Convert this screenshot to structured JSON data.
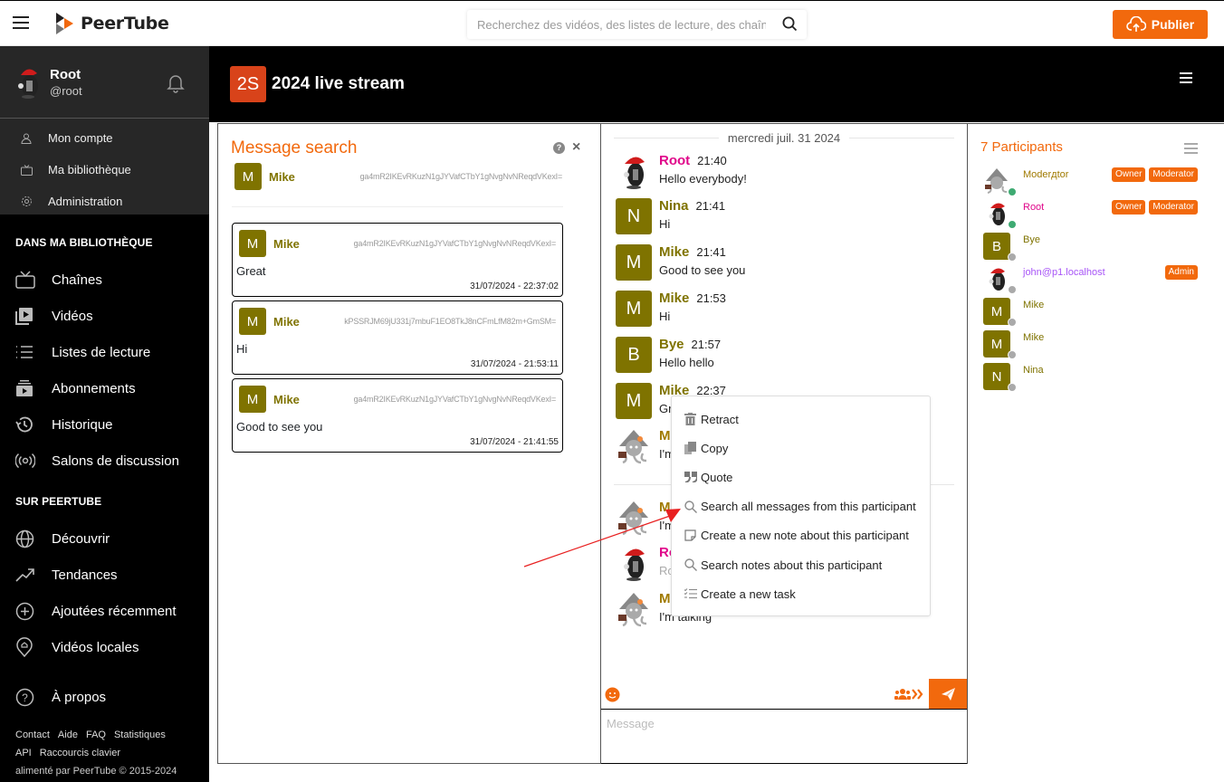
{
  "header": {
    "app_name": "PeerTube",
    "search_placeholder": "Recherchez des vidéos, des listes de lecture, des chaînes…",
    "publish_label": "Publier"
  },
  "sidebar": {
    "user": {
      "name": "Root",
      "handle": "@root"
    },
    "quick_links": [
      {
        "label": "Mon compte",
        "icon": "user-icon"
      },
      {
        "label": "Ma bibliothèque",
        "icon": "tv-icon"
      },
      {
        "label": "Administration",
        "icon": "gear-icon"
      }
    ],
    "library_title": "DANS MA BIBLIOTHÈQUE",
    "library_items": [
      {
        "label": "Chaînes",
        "icon": "tv-icon"
      },
      {
        "label": "Vidéos",
        "icon": "video-play-icon"
      },
      {
        "label": "Listes de lecture",
        "icon": "list-icon"
      },
      {
        "label": "Abonnements",
        "icon": "subscriptions-icon"
      },
      {
        "label": "Historique",
        "icon": "history-icon"
      },
      {
        "label": "Salons de discussion",
        "icon": "broadcast-icon"
      }
    ],
    "peertube_title": "SUR PEERTUBE",
    "peertube_items": [
      {
        "label": "Découvrir",
        "icon": "globe-icon"
      },
      {
        "label": "Tendances",
        "icon": "trending-icon"
      },
      {
        "label": "Ajoutées récemment",
        "icon": "plus-circle-icon"
      },
      {
        "label": "Vidéos locales",
        "icon": "location-icon"
      }
    ],
    "about_label": "À propos",
    "footer_links_row1": [
      "Contact",
      "Aide",
      "FAQ",
      "Statistiques"
    ],
    "footer_links_row2": [
      "API",
      "Raccourcis clavier"
    ],
    "powered_by": "alimenté par PeerTube © 2015-2024"
  },
  "live": {
    "badge": "2S",
    "title": "2024 live stream"
  },
  "message_search": {
    "title": "Message search",
    "help_label": "?",
    "close_label": "×",
    "filter": {
      "initial": "M",
      "name": "Mike",
      "id": "ga4mR2IKEvRKuzN1gJYVafCTbY1gNvgNvNReqdVKexI="
    },
    "results": [
      {
        "initial": "M",
        "name": "Mike",
        "id": "ga4mR2IKEvRKuzN1gJYVafCTbY1gNvgNvNReqdVKexI=",
        "text": "Great",
        "time": "31/07/2024 - 22:37:02"
      },
      {
        "initial": "M",
        "name": "Mike",
        "id": "kPSSRJM69jU331j7mbuF1EO8TkJ8nCFmLfM82m+GmSM=",
        "text": "Hi",
        "time": "31/07/2024 - 21:53:11"
      },
      {
        "initial": "M",
        "name": "Mike",
        "id": "ga4mR2IKEvRKuzN1gJYVafCTbY1gNvgNvNReqdVKexI=",
        "text": "Good to see you",
        "time": "31/07/2024 - 21:41:55"
      }
    ]
  },
  "chat": {
    "date": "mercredi juil. 31 2024",
    "messages": [
      {
        "author": "Root",
        "time": "21:40",
        "text": "Hello everybody!",
        "avatar": "penguin"
      },
      {
        "author": "Nina",
        "time": "21:41",
        "text": "Hi",
        "avatar": "N"
      },
      {
        "author": "Mike",
        "time": "21:41",
        "text": "Good to see you",
        "avatar": "M"
      },
      {
        "author": "Mike",
        "time": "21:53",
        "text": "Hi",
        "avatar": "M"
      },
      {
        "author": "Bye",
        "time": "21:57",
        "text": "Hello hello",
        "avatar": "B"
      },
      {
        "author": "Mike",
        "time": "22:37",
        "text": "Great",
        "avatar": "M"
      },
      {
        "author": "Moderator",
        "time": "",
        "text": "I'm here",
        "avatar": "octopus"
      },
      {
        "author": "Moderator",
        "time": "",
        "text": "I'm here",
        "avatar": "octopus"
      },
      {
        "author": "Root",
        "time": "",
        "text": "Root",
        "avatar": "penguin"
      },
      {
        "author": "Moderator",
        "time": "",
        "text": "I'm talking",
        "avatar": "octopus"
      }
    ],
    "message_placeholder": "Message"
  },
  "context_menu": {
    "items": [
      {
        "label": "Retract",
        "icon": "trash-icon"
      },
      {
        "label": "Copy",
        "icon": "copy-icon"
      },
      {
        "label": "Quote",
        "icon": "quote-icon"
      },
      {
        "label": "Search all messages from this participant",
        "icon": "search-icon"
      },
      {
        "label": "Create a new note about this participant",
        "icon": "note-icon"
      },
      {
        "label": "Search notes about this participant",
        "icon": "search-icon"
      },
      {
        "label": "Create a new task",
        "icon": "task-list-icon"
      }
    ]
  },
  "participants": {
    "title": "7 Participants",
    "list": [
      {
        "name": "Moderдtor",
        "avatar": "octopus",
        "online": true,
        "color": "#a07a00",
        "badges": [
          "Owner",
          "Moderator"
        ]
      },
      {
        "name": "Root",
        "avatar": "penguin",
        "online": true,
        "color": "#e0088a",
        "badges": [
          "Owner",
          "Moderator"
        ]
      },
      {
        "name": "Bye",
        "avatar": "B",
        "online": false,
        "color": "#7f7300",
        "badges": []
      },
      {
        "name": "john@p1.localhost",
        "avatar": "penguin",
        "online": false,
        "color": "#a855f7",
        "badges": [
          "Admin"
        ]
      },
      {
        "name": "Mike",
        "avatar": "M",
        "online": false,
        "color": "#7f7300",
        "badges": []
      },
      {
        "name": "Mike",
        "avatar": "M",
        "online": false,
        "color": "#7f7300",
        "badges": []
      },
      {
        "name": "Nina",
        "avatar": "N",
        "online": false,
        "color": "#7f7300",
        "badges": []
      }
    ]
  },
  "colors": {
    "accent": "#f2690d",
    "avatar_olive": "#7f7300",
    "root_pink": "#e0088a",
    "online_green": "#3eaa72"
  }
}
